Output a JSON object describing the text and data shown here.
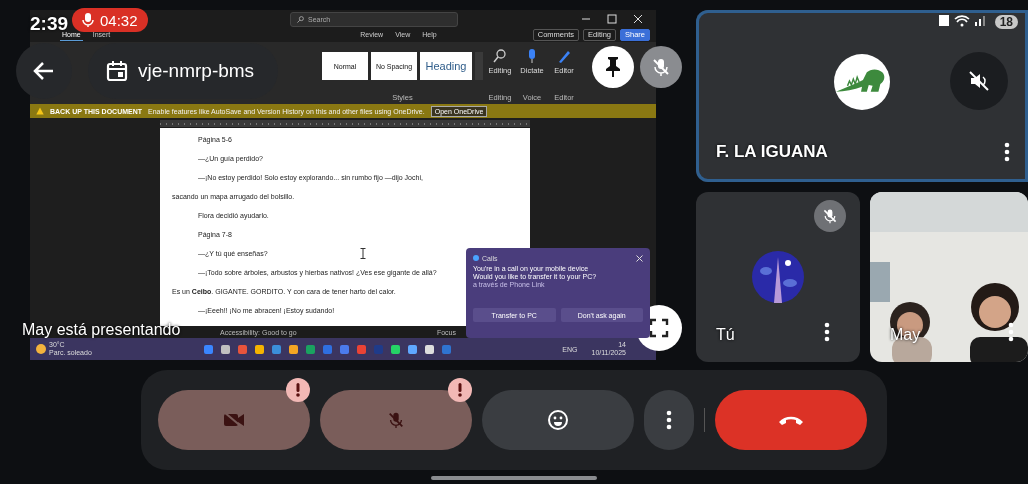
{
  "status_bar": {
    "time": "2:39",
    "battery": "18"
  },
  "recording": {
    "duration": "04:32"
  },
  "meeting": {
    "code": "vje-nmrp-bms"
  },
  "presentation": {
    "caption": "May está presentando",
    "pinned": true,
    "muted": true
  },
  "shared_screen": {
    "word": {
      "search": "Search",
      "tabs": [
        {
          "label": "Home",
          "selected": true
        },
        {
          "label": "Insert",
          "selected": false
        }
      ],
      "tabs_right": [
        {
          "label": "Review",
          "selected": false
        },
        {
          "label": "View",
          "selected": false
        },
        {
          "label": "Help",
          "selected": false
        }
      ],
      "header_buttons": [
        "Comments",
        "Editing",
        "Share"
      ],
      "styles": [
        {
          "label": "Normal",
          "kind": "plain"
        },
        {
          "label": "No Spacing",
          "kind": "plain"
        },
        {
          "label": "Heading",
          "kind": "heading"
        }
      ],
      "ribbon_buttons": [
        {
          "label": "Editing",
          "group": "Editing"
        },
        {
          "label": "Dictate",
          "group": "Voice"
        },
        {
          "label": "Editor",
          "group": "Editor"
        }
      ],
      "styles_group": "Styles",
      "banner": {
        "title": "BACK UP THIS DOCUMENT",
        "message": "Enable features like AutoSave and Version History on this and other files using OneDrive.",
        "button": "Open OneDrive"
      },
      "paragraphs": [
        {
          "lines": [
            "Página 5-6"
          ]
        },
        {
          "lines": [
            "—¿Un guía perdido?"
          ]
        },
        {
          "lines": [
            "—¡No estoy perdido! Solo estoy explorando... sin rumbo fijo —dijo Jochi,",
            "sacando un mapa arrugado del bolsillo."
          ]
        },
        {
          "lines": [
            "Flora decidió ayudarlo."
          ]
        },
        {
          "lines": [
            "Página 7-8"
          ]
        },
        {
          "lines": [
            "—¿Y tú qué enseñas?"
          ]
        },
        {
          "lines": [
            "—¡Todo sobre árboles, arbustos y hierbas nativos! ¿Ves ese gigante de allá?",
            "Es un **Ceibo**. GIGANTE. GORDITO. Y con cara de tener harto del calor."
          ]
        },
        {
          "lines": [
            "—¡Eeeh!! ¡No me abracen! ¡Estoy sudando!"
          ]
        }
      ],
      "status_left": "Accessibility: Good to go",
      "status_right": "Focus"
    },
    "notification": {
      "app": "Calls",
      "message": "You're in a call on your mobile device",
      "question": "Would you like to transfer it to your PC?",
      "source": "a través de Phone Link",
      "buttons": [
        "Transfer to PC",
        "Don't ask again"
      ]
    },
    "taskbar": {
      "temperature": "30°C",
      "weather": "Parc. soleado",
      "language": "ENG",
      "time": "14",
      "date": "10/11/2025"
    }
  },
  "participants": [
    {
      "name": "F. LA IGUANA",
      "kind": "logo",
      "speaking": true,
      "audio_muted": true,
      "muted": false
    },
    {
      "name": "Tú",
      "kind": "avatar",
      "speaking": false,
      "audio_muted": false,
      "muted": true
    },
    {
      "name": "May",
      "kind": "video",
      "speaking": false,
      "audio_muted": false,
      "muted": false
    }
  ],
  "controls": [
    {
      "kind": "camera",
      "on": false,
      "warning": true
    },
    {
      "kind": "mic",
      "on": false,
      "warning": true
    },
    {
      "kind": "emoji"
    },
    {
      "kind": "more"
    },
    {
      "kind": "hangup"
    }
  ]
}
